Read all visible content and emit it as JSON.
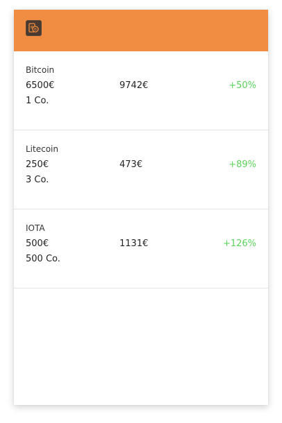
{
  "header": {
    "color": "#F08D42",
    "logo_icon": "crypto-wallet-icon"
  },
  "coins": [
    {
      "name": "Bitcoin",
      "buy_price": "6500€",
      "amount": "1 Co.",
      "value": "9742€",
      "change": "+50%"
    },
    {
      "name": "Litecoin",
      "buy_price": "250€",
      "amount": "3 Co.",
      "value": "473€",
      "change": "+89%"
    },
    {
      "name": "IOTA",
      "buy_price": "500€",
      "amount": "500 Co.",
      "value": "1131€",
      "change": "+126%"
    }
  ],
  "colors": {
    "positive": "#5bd35b"
  }
}
